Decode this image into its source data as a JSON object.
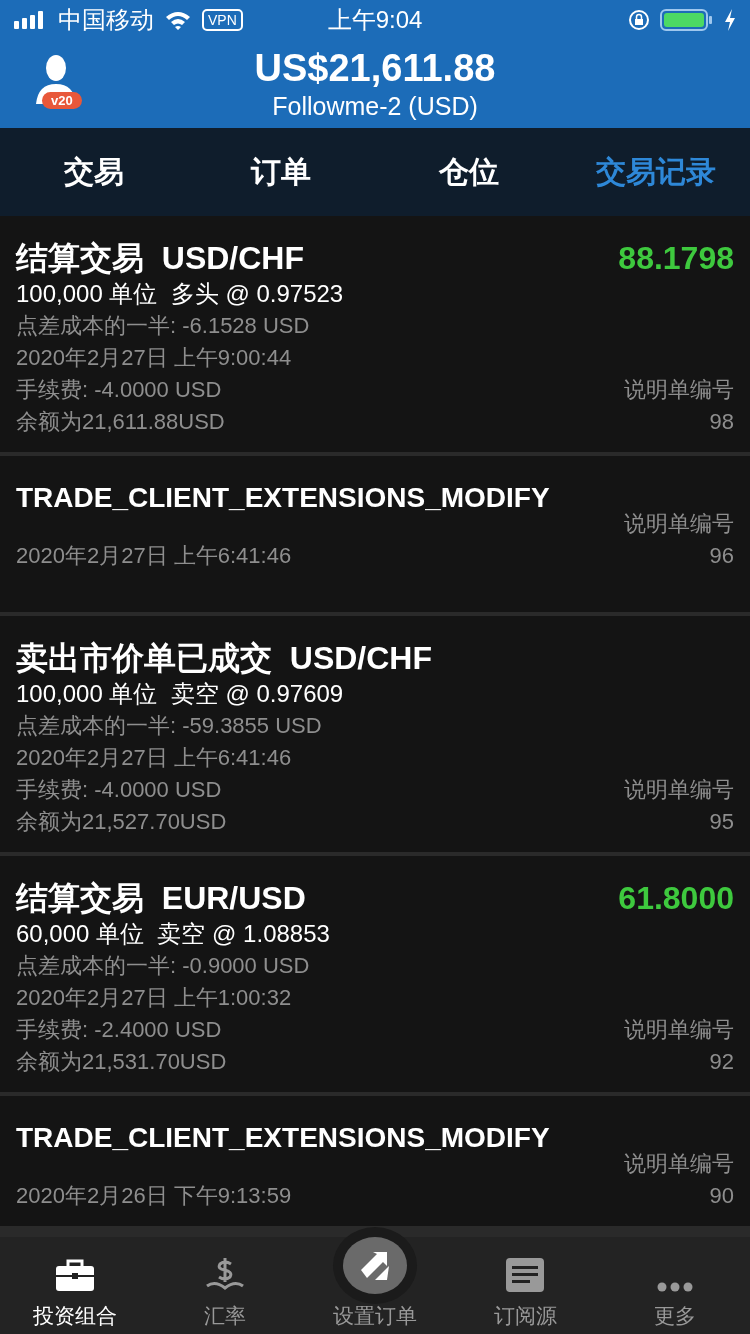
{
  "status_bar": {
    "carrier": "中国移动",
    "vpn": "VPN",
    "time": "上午9:04"
  },
  "header": {
    "balance": "US$21,611.88",
    "account": "Followme-2 (USD)",
    "badge": "v20"
  },
  "tabs": [
    {
      "label": "交易",
      "selected": false
    },
    {
      "label": "订单",
      "selected": false
    },
    {
      "label": "仓位",
      "selected": false
    },
    {
      "label": "交易记录",
      "selected": true
    }
  ],
  "records": [
    {
      "title": "结算交易  USD/CHF",
      "profit": "88.1798",
      "units": "100,000 单位  多头 @ 0.97523",
      "spread": "点差成本的一半: -6.1528 USD",
      "date": "2020年2月27日 上午9:00:44",
      "fee": "手续费: -4.0000 USD",
      "balance": "余额为21,611.88USD",
      "ref_label": "说明单编号",
      "ref_number": "98"
    },
    {
      "title": "TRADE_CLIENT_EXTENSIONS_MODIFY",
      "date": "2020年2月27日 上午6:41:46",
      "ref_label": "说明单编号",
      "ref_number": "96"
    },
    {
      "title": "卖出市价单已成交  USD/CHF",
      "units": "100,000 单位  卖空 @ 0.97609",
      "spread": "点差成本的一半: -59.3855 USD",
      "date": "2020年2月27日 上午6:41:46",
      "fee": "手续费: -4.0000 USD",
      "balance": "余额为21,527.70USD",
      "ref_label": "说明单编号",
      "ref_number": "95"
    },
    {
      "title": "结算交易  EUR/USD",
      "profit": "61.8000",
      "units": "60,000 单位  卖空 @ 1.08853",
      "spread": "点差成本的一半: -0.9000 USD",
      "date": "2020年2月27日 上午1:00:32",
      "fee": "手续费: -2.4000 USD",
      "balance": "余额为21,531.70USD",
      "ref_label": "说明单编号",
      "ref_number": "92"
    },
    {
      "title": "TRADE_CLIENT_EXTENSIONS_MODIFY",
      "date": "2020年2月26日 下午9:13:59",
      "ref_label": "说明单编号",
      "ref_number": "90"
    }
  ],
  "bottom_nav": [
    {
      "label": "投资组合",
      "kind": "briefcase",
      "selected": true
    },
    {
      "label": "汇率",
      "kind": "currency",
      "selected": false
    },
    {
      "label": "设置订单",
      "kind": "exchange",
      "selected": false
    },
    {
      "label": "订阅源",
      "kind": "feed",
      "selected": false
    },
    {
      "label": "更多",
      "kind": "more",
      "selected": false
    }
  ]
}
